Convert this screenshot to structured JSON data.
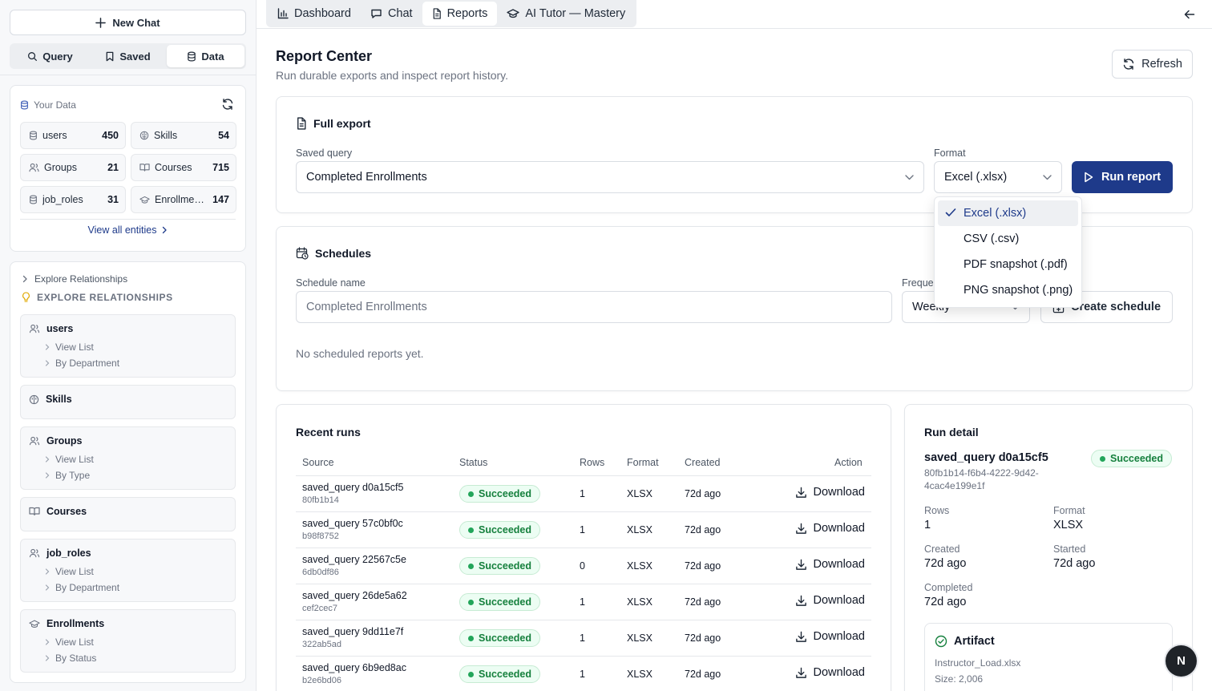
{
  "sidebar": {
    "new_chat_label": "New Chat",
    "segments": [
      {
        "label": "Query",
        "icon": "search-icon"
      },
      {
        "label": "Saved",
        "icon": "bookmark-icon"
      },
      {
        "label": "Data",
        "icon": "database-icon",
        "active": true
      }
    ],
    "your_data": {
      "title": "Your Data",
      "entities": [
        {
          "name": "users",
          "count": "450",
          "icon": "database-icon"
        },
        {
          "name": "Skills",
          "count": "54",
          "icon": "brain-icon"
        },
        {
          "name": "Groups",
          "count": "21",
          "icon": "users-icon"
        },
        {
          "name": "Courses",
          "count": "715",
          "icon": "book-icon"
        },
        {
          "name": "job_roles",
          "count": "31",
          "icon": "database-icon"
        },
        {
          "name": "Enrollmen…",
          "count": "147",
          "icon": "graduation-cap-icon"
        }
      ],
      "view_all_label": "View all entities"
    },
    "explore": {
      "toggle_label": "Explore Relationships",
      "heading": "EXPLORE RELATIONSHIPS",
      "items": [
        {
          "name": "users",
          "icon": "users-icon",
          "subs": [
            "View List",
            "By Department"
          ]
        },
        {
          "name": "Skills",
          "icon": "brain-icon",
          "subs": []
        },
        {
          "name": "Groups",
          "icon": "users-icon",
          "subs": [
            "View List",
            "By Type"
          ]
        },
        {
          "name": "Courses",
          "icon": "book-icon",
          "subs": []
        },
        {
          "name": "job_roles",
          "icon": "users-icon",
          "subs": [
            "View List",
            "By Department"
          ]
        },
        {
          "name": "Enrollments",
          "icon": "graduation-cap-icon",
          "subs": [
            "View List",
            "By Status"
          ]
        }
      ]
    }
  },
  "tabs": [
    {
      "label": "Dashboard",
      "icon": "bar-chart-icon"
    },
    {
      "label": "Chat",
      "icon": "chat-icon"
    },
    {
      "label": "Reports",
      "icon": "file-icon",
      "active": true
    },
    {
      "label": "AI Tutor — Mastery",
      "icon": "graduation-cap-icon"
    }
  ],
  "header": {
    "title": "Report Center",
    "subtitle": "Run durable exports and inspect report history.",
    "refresh_label": "Refresh"
  },
  "full_export": {
    "title": "Full export",
    "saved_query_label": "Saved query",
    "saved_query_value": "Completed Enrollments",
    "format_label": "Format",
    "format_value": "Excel (.xlsx)",
    "run_label": "Run report",
    "format_options": [
      "Excel (.xlsx)",
      "CSV (.csv)",
      "PDF snapshot (.pdf)",
      "PNG snapshot (.png)"
    ],
    "selected_option": "Excel (.xlsx)"
  },
  "schedules": {
    "title": "Schedules",
    "name_label": "Schedule name",
    "name_placeholder": "Completed Enrollments",
    "frequency_label": "Freque",
    "frequency_value": "Weekly",
    "create_label": "Create schedule",
    "empty_text": "No scheduled reports yet."
  },
  "recent_runs": {
    "title": "Recent runs",
    "columns": [
      "Source",
      "Status",
      "Rows",
      "Format",
      "Created",
      "Action"
    ],
    "rows": [
      {
        "source": "saved_query d0a15cf5",
        "id": "80fb1b14",
        "status": "Succeeded",
        "rows": "1",
        "format": "XLSX",
        "created": "72d ago",
        "action": "Download"
      },
      {
        "source": "saved_query 57c0bf0c",
        "id": "b98f8752",
        "status": "Succeeded",
        "rows": "1",
        "format": "XLSX",
        "created": "72d ago",
        "action": "Download"
      },
      {
        "source": "saved_query 22567c5e",
        "id": "6db0df86",
        "status": "Succeeded",
        "rows": "0",
        "format": "XLSX",
        "created": "72d ago",
        "action": "Download"
      },
      {
        "source": "saved_query 26de5a62",
        "id": "cef2cec7",
        "status": "Succeeded",
        "rows": "1",
        "format": "XLSX",
        "created": "72d ago",
        "action": "Download"
      },
      {
        "source": "saved_query 9dd11e7f",
        "id": "322ab5ad",
        "status": "Succeeded",
        "rows": "1",
        "format": "XLSX",
        "created": "72d ago",
        "action": "Download"
      },
      {
        "source": "saved_query 6b9ed8ac",
        "id": "b2e6bd06",
        "status": "Succeeded",
        "rows": "1",
        "format": "XLSX",
        "created": "72d ago",
        "action": "Download"
      }
    ]
  },
  "run_detail": {
    "title": "Run detail",
    "name": "saved_query d0a15cf5",
    "id": "80fb1b14-f6b4-4222-9d42-4cac4e199e1f",
    "status": "Succeeded",
    "rows_label": "Rows",
    "rows_value": "1",
    "format_label": "Format",
    "format_value": "XLSX",
    "created_label": "Created",
    "created_value": "72d ago",
    "started_label": "Started",
    "started_value": "72d ago",
    "completed_label": "Completed",
    "completed_value": "72d ago",
    "artifact_title": "Artifact",
    "artifact_file": "Instructor_Load.xlsx",
    "artifact_size": "Size: 2,006"
  },
  "fab_letter": "N",
  "colors": {
    "accent": "#1e3a8a",
    "success": "#15803d",
    "success_bg": "#ecfdf3"
  }
}
